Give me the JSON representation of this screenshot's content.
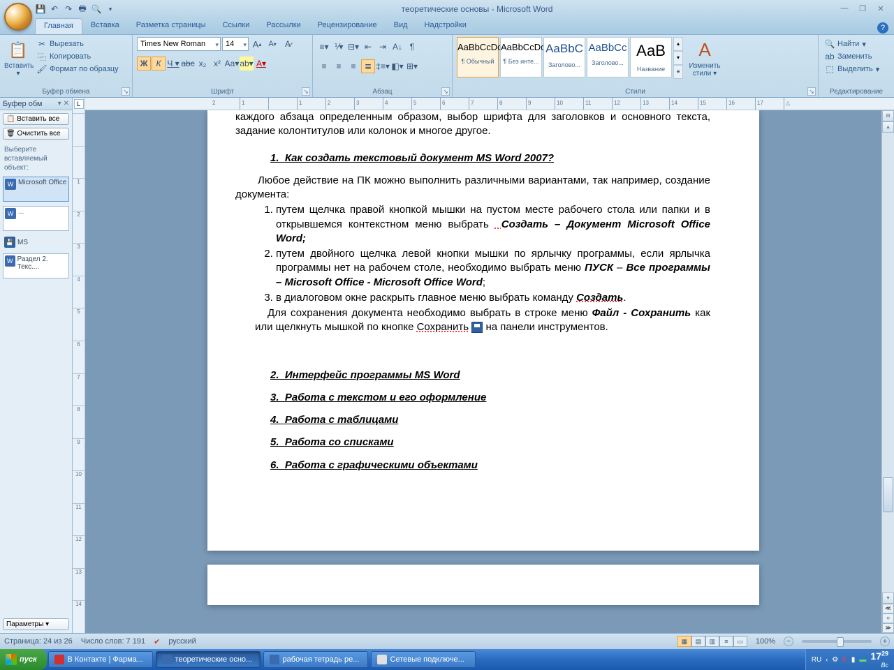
{
  "title": "теоретические основы - Microsoft Word",
  "tabs": [
    "Главная",
    "Вставка",
    "Разметка страницы",
    "Ссылки",
    "Рассылки",
    "Рецензирование",
    "Вид",
    "Надстройки"
  ],
  "active_tab": 0,
  "ribbon": {
    "clipboard": {
      "label": "Буфер обмена",
      "paste": "Вставить",
      "cut": "Вырезать",
      "copy": "Копировать",
      "format_painter": "Формат по образцу"
    },
    "font": {
      "label": "Шрифт",
      "name": "Times New Roman",
      "size": "14"
    },
    "paragraph": {
      "label": "Абзац"
    },
    "styles": {
      "label": "Стили",
      "items": [
        {
          "preview": "AaBbCcDc",
          "name": "¶ Обычный"
        },
        {
          "preview": "AaBbCcDc",
          "name": "¶ Без инте..."
        },
        {
          "preview": "AaBbC",
          "name": "Заголово..."
        },
        {
          "preview": "AaBbCc",
          "name": "Заголово..."
        },
        {
          "preview": "АаВ",
          "name": "Название"
        }
      ],
      "change": "Изменить стили"
    },
    "editing": {
      "label": "Редактирование",
      "find": "Найти",
      "replace": "Заменить",
      "select": "Выделить"
    }
  },
  "clipboard_pane": {
    "title": "Буфер обм",
    "paste_all": "Вставить все",
    "clear_all": "Очистить все",
    "hint": "Выберите вставляемый объект:",
    "items": [
      {
        "text": "Microsoft Office"
      },
      {
        "text": "..."
      },
      {
        "text": "MS",
        "save": true
      },
      {
        "text": "Раздел 2. Текс...."
      }
    ],
    "params": "Параметры"
  },
  "ruler_h": [
    "2",
    "1",
    "",
    "1",
    "2",
    "3",
    "4",
    "5",
    "6",
    "7",
    "8",
    "9",
    "10",
    "11",
    "12",
    "13",
    "14",
    "15",
    "16",
    "17",
    "△"
  ],
  "vr_ticks": [
    "",
    "",
    "1",
    "2",
    "3",
    "4",
    "5",
    "6",
    "7",
    "8",
    "9",
    "10",
    "11",
    "12",
    "13",
    "14"
  ],
  "doc": {
    "top_fragment": "каждого абзаца определенным образом, выбор шрифта для заголовков и основного текста, задание колонтитулов или колонок и многое другое.",
    "h1_num": "1.",
    "h1": "Как создать текстовый документ MS Word 2007?",
    "p1": "Любое действие на ПК можно выполнить различными вариантами, так например, создание документа:",
    "li1a": "путем щелчка правой кнопкой мышки на пустом месте рабочего стола или папки и в открывшемся контекстном меню выбрать ",
    "li1b": "Создать – Документ Microsoft  Office Word;",
    "li2a": "путем двойного щелчка левой кнопки мышки по ярлычку программы, если ярлычка программы нет на рабочем столе, необходимо выбрать меню ",
    "li2b": "ПУСК",
    "li2c": " – ",
    "li2d": "Все программы – Microsoft  Office - Microsoft  Office Word",
    "li2e": ";",
    "li3a": "в диалоговом окне раскрыть главное меню  выбрать команду ",
    "li3b": "Создать",
    "li3c": ".",
    "p2a": "Для сохранения документа необходимо выбрать в строке меню ",
    "p2b": "Файл - Сохранить",
    "p2c": " как или щелкнуть мышкой по кнопке ",
    "p2d": "Сохранить",
    "p2e": " на панели инструментов.",
    "h2n": "2.",
    "h2": "Интерфейс программы MS Word",
    "h3n": "3.",
    "h3": "Работа с текстом и его оформление",
    "h4n": "4.",
    "h4": "Работа с таблицами",
    "h5n": "5.",
    "h5": "Работа со списками",
    "h6n": "6.",
    "h6": "Работа с графическими объектами"
  },
  "status": {
    "page": "Страница: 24 из 26",
    "words": "Число слов: 7 191",
    "lang": "русский",
    "zoom": "100%"
  },
  "taskbar": {
    "start": "пуск",
    "items": [
      {
        "label": "В Контакте | Фарма...",
        "color": "#d03030"
      },
      {
        "label": "теоретические осно...",
        "color": "#3a6ab0",
        "active": true
      },
      {
        "label": "рабочая тетрадь ре...",
        "color": "#3a6ab0"
      },
      {
        "label": "Сетевые подключе...",
        "color": "#e0e0e0"
      }
    ],
    "lang": "RU",
    "time": "17",
    "time_min": "29",
    "day": "Вс"
  }
}
